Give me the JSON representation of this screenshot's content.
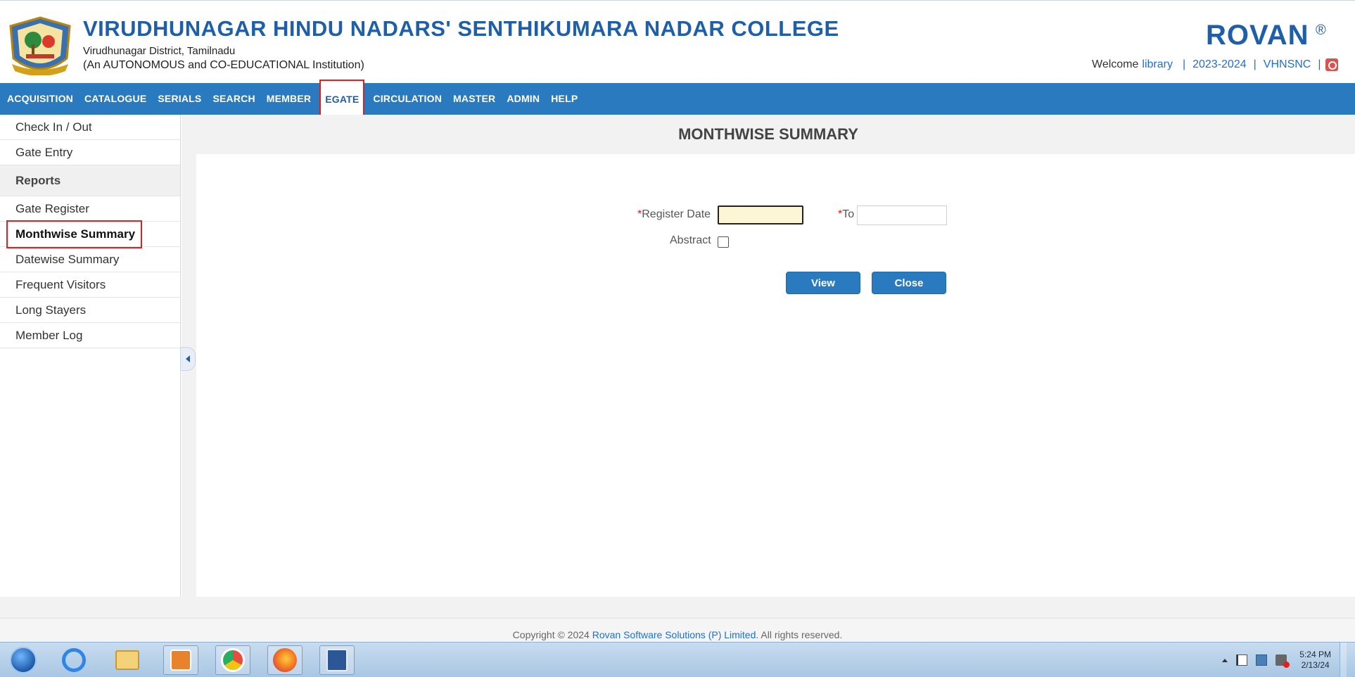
{
  "header": {
    "college_name": "VIRUDHUNAGAR HINDU NADARS' SENTHIKUMARA NADAR COLLEGE",
    "district": "Virudhunagar District, Tamilnadu",
    "institution_type": "(An AUTONOMOUS and CO-EDUCATIONAL Institution)",
    "brand": "ROVAN",
    "brand_reg": "®",
    "welcome_label": "Welcome",
    "username": "library",
    "academic_year": "2023-2024",
    "institution_code": "VHNSNC",
    "separator": "|"
  },
  "nav": {
    "items": [
      {
        "label": "ACQUISITION"
      },
      {
        "label": "CATALOGUE"
      },
      {
        "label": "SERIALS"
      },
      {
        "label": "SEARCH"
      },
      {
        "label": "MEMBER"
      },
      {
        "label": "EGATE",
        "active": true
      },
      {
        "label": "CIRCULATION"
      },
      {
        "label": "MASTER"
      },
      {
        "label": "ADMIN"
      },
      {
        "label": "HELP"
      }
    ]
  },
  "sidebar": {
    "items": [
      {
        "label": "Check In / Out"
      },
      {
        "label": "Gate Entry"
      },
      {
        "label": "Reports",
        "header": true
      },
      {
        "label": "Gate Register"
      },
      {
        "label": "Monthwise Summary",
        "selected": true
      },
      {
        "label": "Datewise Summary"
      },
      {
        "label": "Frequent Visitors"
      },
      {
        "label": "Long Stayers"
      },
      {
        "label": "Member Log"
      }
    ]
  },
  "main": {
    "title": "MONTHWISE SUMMARY",
    "form": {
      "required_mark": "*",
      "register_date_label": "Register Date",
      "register_date_value": "",
      "to_label": "To",
      "to_value": "",
      "abstract_label": "Abstract",
      "abstract_checked": false,
      "view_label": "View",
      "close_label": "Close"
    }
  },
  "footer": {
    "prefix": "Copyright © 2024",
    "company": "Rovan Software Solutions (P) Limited",
    "suffix": ". All rights reserved."
  },
  "taskbar": {
    "apps": [
      "start-orb",
      "internet-explorer",
      "file-explorer",
      "outlook",
      "chrome",
      "firefox",
      "word"
    ],
    "clock_time": "5:24 PM",
    "clock_date": "2/13/24"
  },
  "colors": {
    "nav_bg": "#2a7abf",
    "brand": "#1f5fa8",
    "highlight": "#e02020",
    "date_input_bg": "#fdf6d4"
  }
}
